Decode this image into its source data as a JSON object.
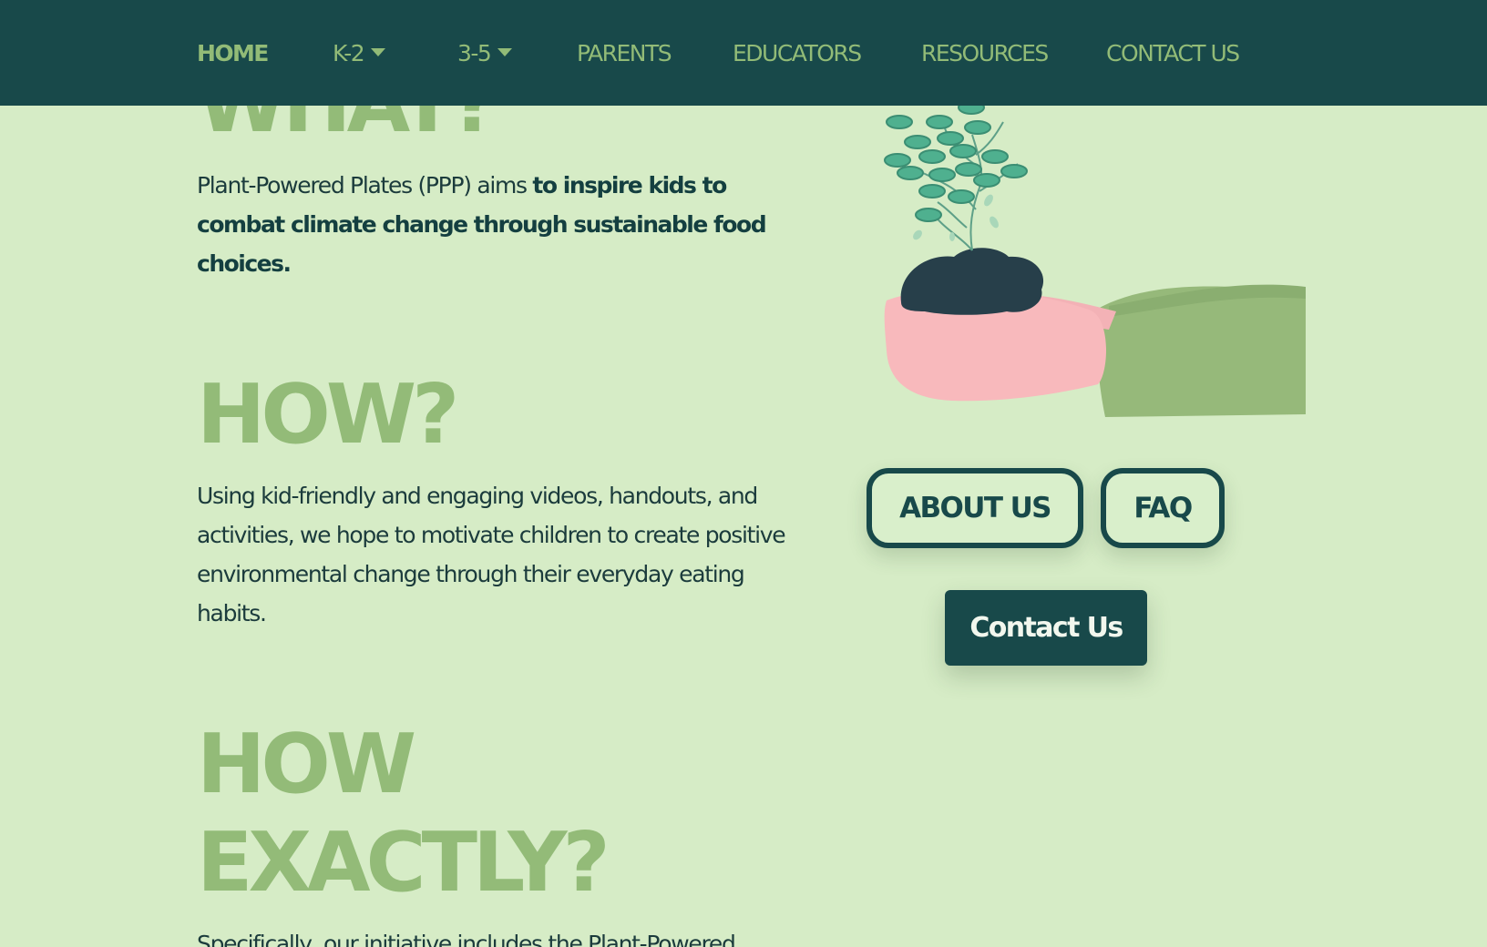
{
  "nav": {
    "home": "HOME",
    "k2": "K-2",
    "grades35": "3-5",
    "parents": "PARENTS",
    "educators": "EDUCATORS",
    "resources": "RESOURCES",
    "contact": "CONTACT US"
  },
  "sections": {
    "what": {
      "heading": "WHAT?",
      "text_plain": "Plant-Powered Plates (PPP) aims ",
      "text_bold": "to inspire kids to combat climate change through sustainable food choices."
    },
    "how": {
      "heading": "HOW?",
      "text": "Using kid-friendly and engaging videos, handouts, and activities, we hope to motivate children to create positive environmental change through their everyday eating habits."
    },
    "how_exactly": {
      "heading_line1": "HOW",
      "heading_line2": "EXACTLY?",
      "text": "Specifically, our initiative includes the Plant-Powered"
    }
  },
  "buttons": {
    "about": "ABOUT US",
    "faq": "FAQ",
    "contact": "Contact Us"
  },
  "colors": {
    "background": "#d6ecc6",
    "nav_background": "#18494a",
    "accent_green": "#93bb78",
    "dark_teal": "#18494a",
    "hand_pink": "#f6b9bc",
    "leaf_teal": "#4fb08f"
  },
  "icons": {
    "k2_dropdown": "caret-down-icon",
    "grades35_dropdown": "caret-down-icon",
    "illustration": "hand-holding-plant-illustration"
  }
}
